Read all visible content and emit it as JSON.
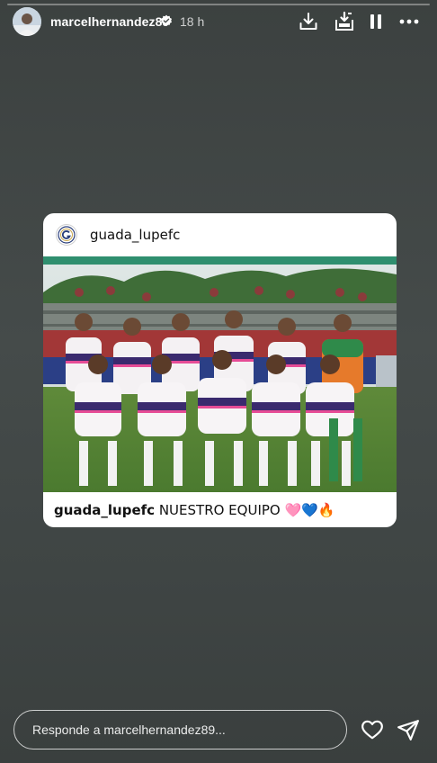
{
  "story": {
    "progress": 0.0,
    "username": "marcelhernandez89",
    "time": "18 h",
    "icons": [
      "download-icon",
      "save-to-device-icon",
      "pause-icon",
      "more-icon",
      "verified-badge-icon"
    ]
  },
  "post": {
    "username": "guada_lupefc",
    "caption_user": "guada_lupefc",
    "caption_text": "NUESTRO EQUIPO 🩷💙🔥",
    "image_alt": "team photo"
  },
  "reply": {
    "placeholder": "Responde a marcelhernandez89..."
  },
  "footer": {
    "icons": [
      "heart-icon",
      "send-icon"
    ]
  }
}
